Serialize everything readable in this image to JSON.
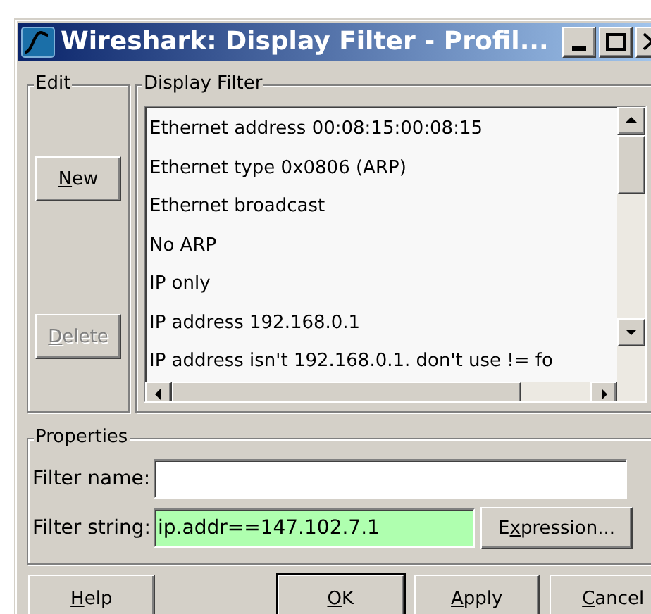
{
  "window": {
    "title": "Wireshark: Display Filter - Profil..."
  },
  "edit": {
    "title": "Edit",
    "buttons": [
      {
        "label": [
          {
            "text": "N",
            "underlined": true
          },
          {
            "text": "ew",
            "underlined": false
          }
        ],
        "disabled": false
      },
      {
        "label": [
          {
            "text": "D",
            "underlined": true
          },
          {
            "text": "elete",
            "underlined": false
          }
        ],
        "disabled": true
      }
    ]
  },
  "display_filter": {
    "title": "Display Filter",
    "items": [
      {
        "label": "Ethernet address 00:08:15:00:08:15",
        "selected": false
      },
      {
        "label": "Ethernet type 0x0806 (ARP)",
        "selected": false
      },
      {
        "label": "Ethernet broadcast",
        "selected": false
      },
      {
        "label": "No ARP",
        "selected": false
      },
      {
        "label": "IP only",
        "selected": false
      },
      {
        "label": "IP address 192.168.0.1",
        "selected": false
      },
      {
        "label": "IP address isn't 192.168.0.1. don't use != fo",
        "selected": false
      }
    ]
  },
  "properties": {
    "title": "Properties",
    "filter_name": {
      "label": "Filter name:"
    },
    "filter_string": {
      "label": "Filter string:",
      "value": "ip.addr==147.102.7.1",
      "valid": true
    },
    "expression_button": {
      "label": [
        {
          "text": "E",
          "underlined": false
        },
        {
          "text": "x",
          "underlined": true
        },
        {
          "text": "pression...",
          "underlined": false
        }
      ]
    }
  },
  "buttons": [
    {
      "label": [
        {
          "text": "H",
          "underlined": true
        },
        {
          "text": "elp",
          "underlined": false
        }
      ],
      "default": false
    },
    {
      "label": [
        {
          "text": "O",
          "underlined": true
        },
        {
          "text": "K",
          "underlined": false
        }
      ],
      "default": true
    },
    {
      "label": [
        {
          "text": "A",
          "underlined": true
        },
        {
          "text": "pply",
          "underlined": false
        }
      ],
      "default": false
    },
    {
      "label": [
        {
          "text": "C",
          "underlined": true
        },
        {
          "text": "ancel",
          "underlined": false
        }
      ],
      "default": false
    }
  ]
}
